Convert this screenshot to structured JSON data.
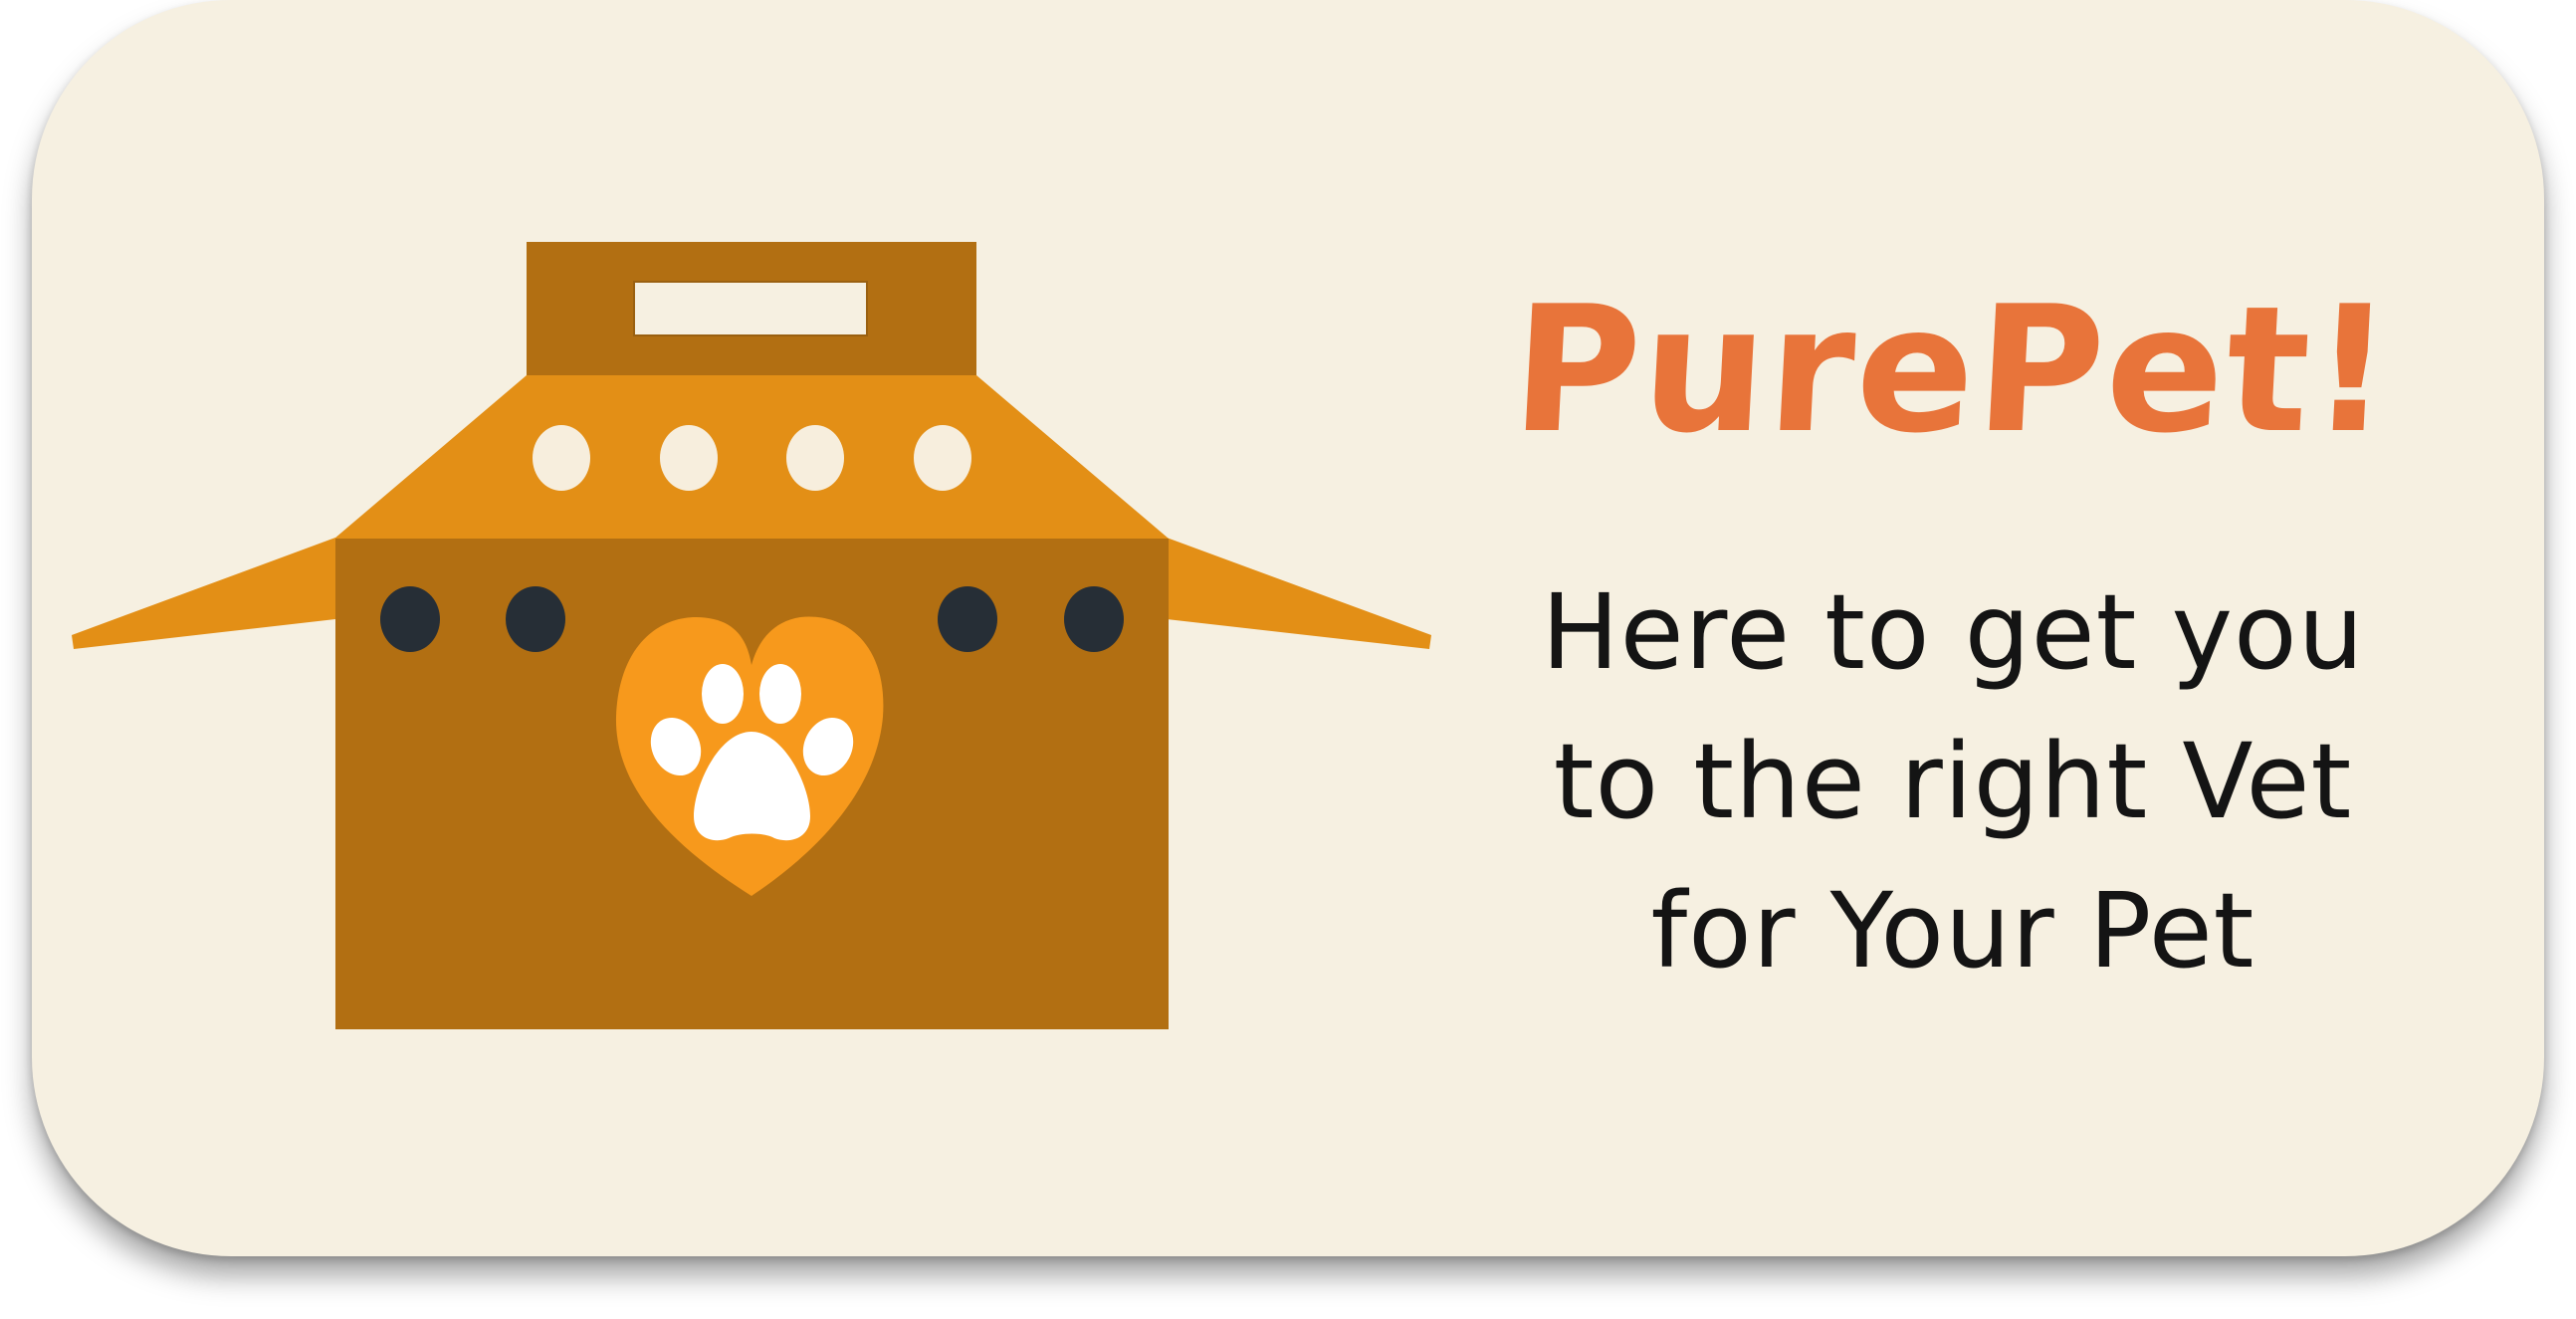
{
  "brand": {
    "name": "PurePet!",
    "color": "#e8743a"
  },
  "tagline": {
    "lines": [
      "Here to get you",
      "to the right Vet",
      "for Your Pet"
    ],
    "color": "#141414"
  },
  "illustration": {
    "icon": "pet-carrier-icon",
    "emblem_icon": "heart-paw-icon",
    "colors": {
      "box": "#b26f12",
      "lid": "#e38f16",
      "heart": "#f7991c",
      "vent_holes": "#262e36",
      "background": "#f6f0e1"
    }
  }
}
